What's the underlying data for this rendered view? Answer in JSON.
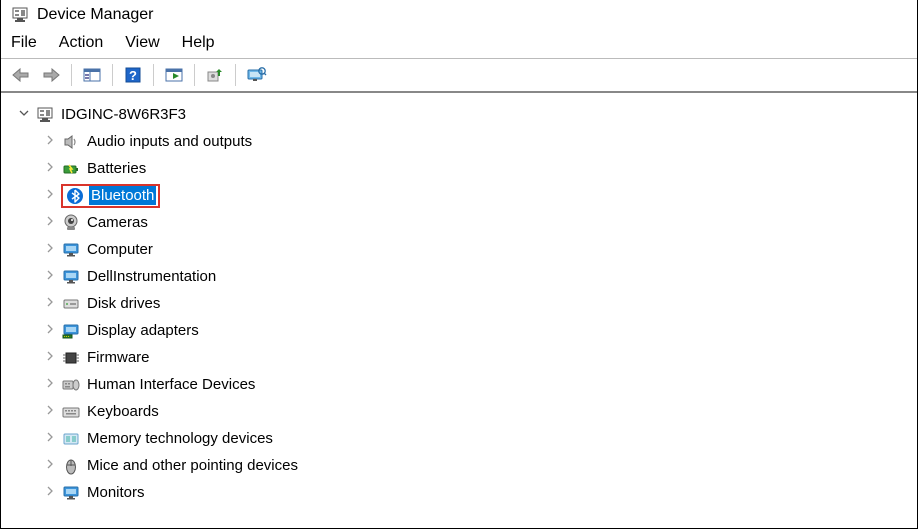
{
  "window": {
    "title": "Device Manager"
  },
  "menu": {
    "file": "File",
    "action": "Action",
    "view": "View",
    "help": "Help"
  },
  "root": {
    "expanded": true,
    "label": "IDGINC-8W6R3F3"
  },
  "categories": [
    {
      "id": "audio",
      "label": "Audio inputs and outputs"
    },
    {
      "id": "batteries",
      "label": "Batteries"
    },
    {
      "id": "bluetooth",
      "label": "Bluetooth",
      "highlighted": true
    },
    {
      "id": "cameras",
      "label": "Cameras"
    },
    {
      "id": "computer",
      "label": "Computer"
    },
    {
      "id": "dellinst",
      "label": "DellInstrumentation"
    },
    {
      "id": "diskdrives",
      "label": "Disk drives"
    },
    {
      "id": "display",
      "label": "Display adapters"
    },
    {
      "id": "firmware",
      "label": "Firmware"
    },
    {
      "id": "hid",
      "label": "Human Interface Devices"
    },
    {
      "id": "keyboards",
      "label": "Keyboards"
    },
    {
      "id": "memtech",
      "label": "Memory technology devices"
    },
    {
      "id": "mice",
      "label": "Mice and other pointing devices"
    },
    {
      "id": "monitors",
      "label": "Monitors"
    }
  ]
}
